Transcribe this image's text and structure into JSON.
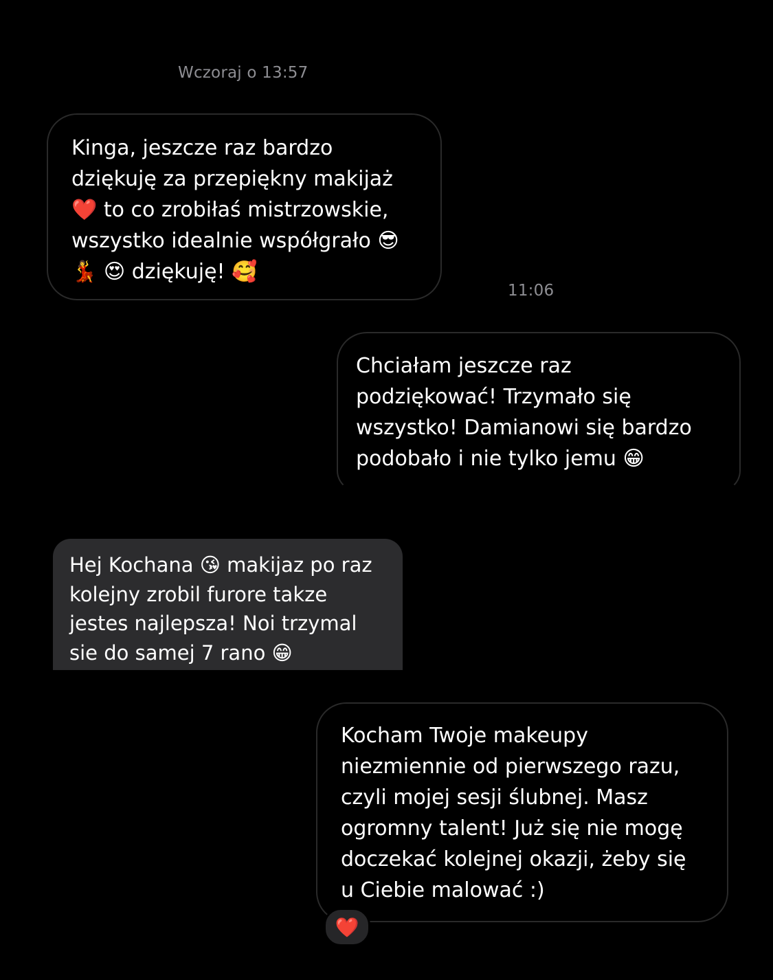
{
  "timestamps": {
    "first": "Wczoraj o 13:57",
    "second": "11:06"
  },
  "messages": [
    {
      "sender": "received",
      "lines": [
        "Kinga, jeszcze raz bardzo",
        "dziękuję za przepiękny makijaż",
        "❤️  to co zrobiłaś mistrzowskie,",
        "wszystko idealnie współgrało 😎",
        "💃 😍  dziękuję! 🥰"
      ]
    },
    {
      "sender": "received",
      "lines": [
        "Chciałam jeszcze raz",
        "podziękować! Trzymało się",
        "wszystko! Damianowi się bardzo",
        "podobało i nie tylko jemu 😁"
      ]
    },
    {
      "sender": "received",
      "lines": [
        "Hej Kochana 😘 makijaz po raz",
        "kolejny zrobil furore takze",
        "jestes najlepsza! Noi trzymal",
        "sie do samej 7 rano 😁"
      ]
    },
    {
      "sender": "received",
      "lines": [
        "Kocham Twoje makeupy",
        "niezmiennie od pierwszego razu,",
        "czyli mojej sesji ślubnej. Masz",
        "ogromny talent! Już się nie mogę",
        "doczekać kolejnej okazji, żeby się",
        "u Ciebie malować :)"
      ],
      "reaction": "❤️"
    }
  ]
}
